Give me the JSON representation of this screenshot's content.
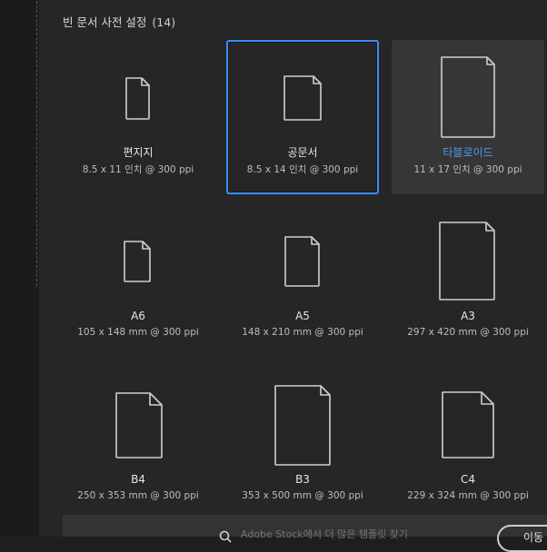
{
  "section": {
    "title": "빈 문서 사전 설정",
    "count": "(14)"
  },
  "presets": [
    {
      "name": "편지지",
      "dims": "8.5 x 11 인치 @ 300 ppi",
      "state": "normal"
    },
    {
      "name": "공문서",
      "dims": "8.5 x 14 인치 @ 300 ppi",
      "state": "selected"
    },
    {
      "name": "타블로이드",
      "dims": "11 x 17 인치 @ 300 ppi",
      "state": "hovered"
    },
    {
      "name": "A6",
      "dims": "105 x 148 mm @ 300 ppi",
      "state": "normal"
    },
    {
      "name": "A5",
      "dims": "148 x 210 mm @ 300 ppi",
      "state": "normal"
    },
    {
      "name": "A3",
      "dims": "297 x 420 mm @ 300 ppi",
      "state": "normal"
    },
    {
      "name": "B4",
      "dims": "250 x 353 mm @ 300 ppi",
      "state": "normal"
    },
    {
      "name": "B3",
      "dims": "353 x 500 mm @ 300 ppi",
      "state": "normal"
    },
    {
      "name": "C4",
      "dims": "229 x 324 mm @ 300 ppi",
      "state": "normal"
    }
  ],
  "search": {
    "placeholder": "Adobe Stock에서 더 많은 템플릿 찾기"
  },
  "open_button": {
    "label": "이동"
  },
  "colors": {
    "accent": "#3b8ef5",
    "hover_text": "#4b9bf7",
    "panel": "#262626"
  }
}
